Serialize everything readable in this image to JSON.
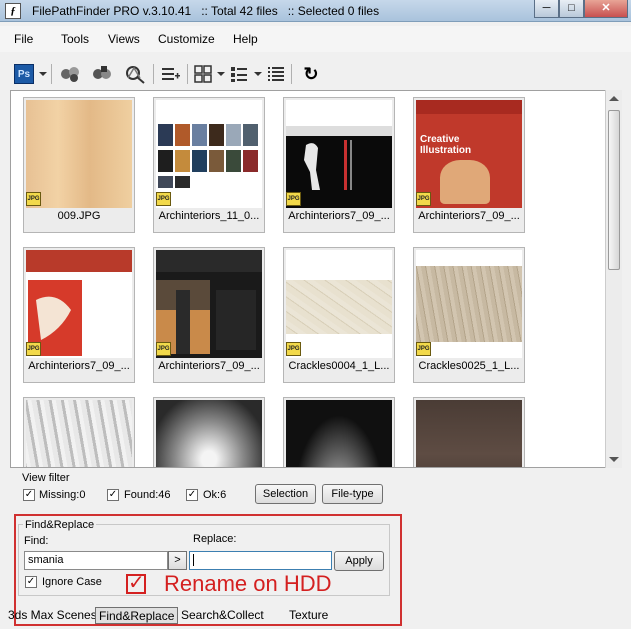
{
  "window": {
    "app_name": "FilePathFinder PRO v.3.10.41",
    "total": ":: Total 42 files",
    "selected": ":: Selected 0 files",
    "minimize": "─",
    "maximize": "□",
    "close": "✕"
  },
  "menu": [
    "File",
    "Tools",
    "Views",
    "Customize",
    "Help"
  ],
  "toolbar": {
    "ps_label": "Ps",
    "icons": [
      "photoshop-icon",
      "find-files-icon",
      "collect-icon",
      "search-replace-icon",
      "add-list-icon",
      "grid-view-icon",
      "details-view-icon",
      "list-view-icon",
      "refresh-icon"
    ],
    "refresh": "↻"
  },
  "thumbnails": [
    {
      "caption": "009.JPG",
      "kind": "wood",
      "badge": "JPG"
    },
    {
      "caption": "Archinteriors_11_0...",
      "kind": "collage",
      "badge": "JPG"
    },
    {
      "caption": "Archinteriors7_09_...",
      "kind": "sculpture",
      "badge": "JPG"
    },
    {
      "caption": "Archinteriors7_09_...",
      "kind": "creative",
      "badge": "JPG"
    },
    {
      "caption": "Archinteriors7_09_...",
      "kind": "poster",
      "badge": "JPG"
    },
    {
      "caption": "Archinteriors7_09_...",
      "kind": "dark",
      "badge": "JPG"
    },
    {
      "caption": "Crackles0004_1_L...",
      "kind": "crackle",
      "badge": "JPG"
    },
    {
      "caption": "Crackles0025_1_L...",
      "kind": "crackle2",
      "badge": "JPG"
    },
    {
      "caption": "",
      "kind": "silver",
      "badge": ""
    },
    {
      "caption": "",
      "kind": "radial",
      "badge": ""
    },
    {
      "caption": "",
      "kind": "spot",
      "badge": ""
    },
    {
      "caption": "",
      "kind": "brown",
      "badge": ""
    }
  ],
  "thumb_texts": {
    "creative_title": "Creative Illustration"
  },
  "view_filter": {
    "label": "View filter",
    "missing": "Missing:0",
    "found": "Found:46",
    "ok": "Ok:6",
    "selection_button": "Selection",
    "filetype_button": "File-type"
  },
  "find_replace": {
    "group_label": "Find&Replace",
    "find_label": "Find:",
    "replace_label": "Replace:",
    "find_value": "smania",
    "replace_value": "",
    "arrow_button": ">",
    "apply_button": "Apply",
    "ignore_case": "Ignore Case",
    "rename_on_hdd": "Rename on HDD"
  },
  "tabs": [
    "3ds Max Scenes",
    "Find&Replace",
    "Search&Collect",
    "Texture"
  ]
}
